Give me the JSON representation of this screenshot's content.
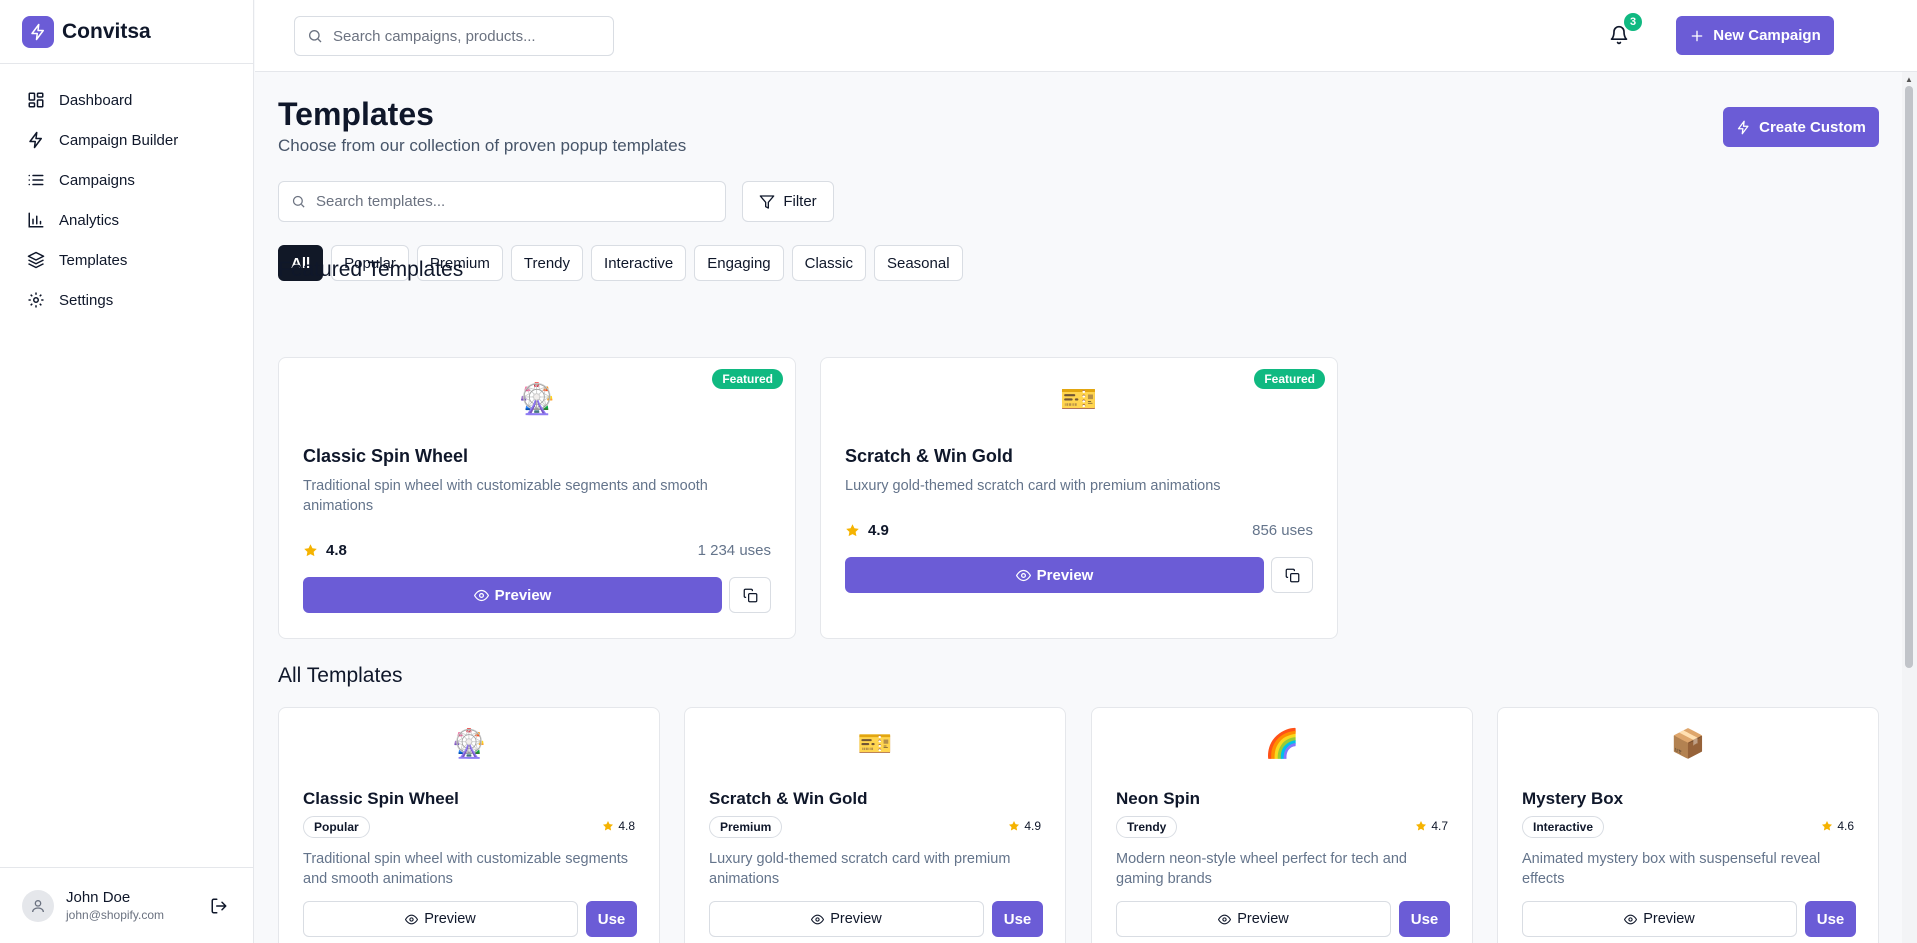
{
  "app": {
    "name": "Convitsa"
  },
  "nav": [
    {
      "label": "Dashboard",
      "icon": "dashboard-icon"
    },
    {
      "label": "Campaign Builder",
      "icon": "zap-icon"
    },
    {
      "label": "Campaigns",
      "icon": "list-icon"
    },
    {
      "label": "Analytics",
      "icon": "chart-icon"
    },
    {
      "label": "Templates",
      "icon": "layers-icon"
    },
    {
      "label": "Settings",
      "icon": "gear-icon"
    }
  ],
  "user": {
    "name": "John Doe",
    "email": "john@shopify.com"
  },
  "topbar": {
    "search_placeholder": "Search campaigns, products...",
    "new_campaign": "New Campaign",
    "notifications": "3"
  },
  "page": {
    "title": "Templates",
    "subtitle": "Choose from our collection of proven popup templates",
    "create_custom": "Create Custom",
    "search_placeholder": "Search templates...",
    "filter": "Filter",
    "categories": [
      "All",
      "Popular",
      "Premium",
      "Trendy",
      "Interactive",
      "Engaging",
      "Classic",
      "Seasonal"
    ],
    "active_category": "All"
  },
  "featured": {
    "title": "Featured Templates",
    "items": [
      {
        "emoji": "🎡",
        "badge": "Featured",
        "name": "Classic Spin Wheel",
        "description": "Traditional spin wheel with customizable segments and smooth animations",
        "rating": "4.8",
        "uses": "1 234 uses",
        "preview": "Preview"
      },
      {
        "emoji": "🎫",
        "badge": "Featured",
        "name": "Scratch & Win Gold",
        "description": "Luxury gold-themed scratch card with premium animations",
        "rating": "4.9",
        "uses": "856 uses",
        "preview": "Preview"
      }
    ]
  },
  "all": {
    "title": "All Templates",
    "items": [
      {
        "emoji": "🎡",
        "name": "Classic Spin Wheel",
        "category": "Popular",
        "rating": "4.8",
        "description": "Traditional spin wheel with customizable segments and smooth animations",
        "preview": "Preview",
        "use": "Use"
      },
      {
        "emoji": "🎫",
        "name": "Scratch & Win Gold",
        "category": "Premium",
        "rating": "4.9",
        "description": "Luxury gold-themed scratch card with premium animations",
        "preview": "Preview",
        "use": "Use"
      },
      {
        "emoji": "🌈",
        "name": "Neon Spin",
        "category": "Trendy",
        "rating": "4.7",
        "description": "Modern neon-style wheel perfect for tech and gaming brands",
        "preview": "Preview",
        "use": "Use"
      },
      {
        "emoji": "📦",
        "name": "Mystery Box",
        "category": "Interactive",
        "rating": "4.6",
        "description": "Animated mystery box with suspenseful reveal effects",
        "preview": "Preview",
        "use": "Use"
      }
    ]
  },
  "colors": {
    "accent": "#6b5cd6",
    "featured_badge": "#10b981",
    "star": "#f5b301",
    "active_chip": "#111827"
  }
}
